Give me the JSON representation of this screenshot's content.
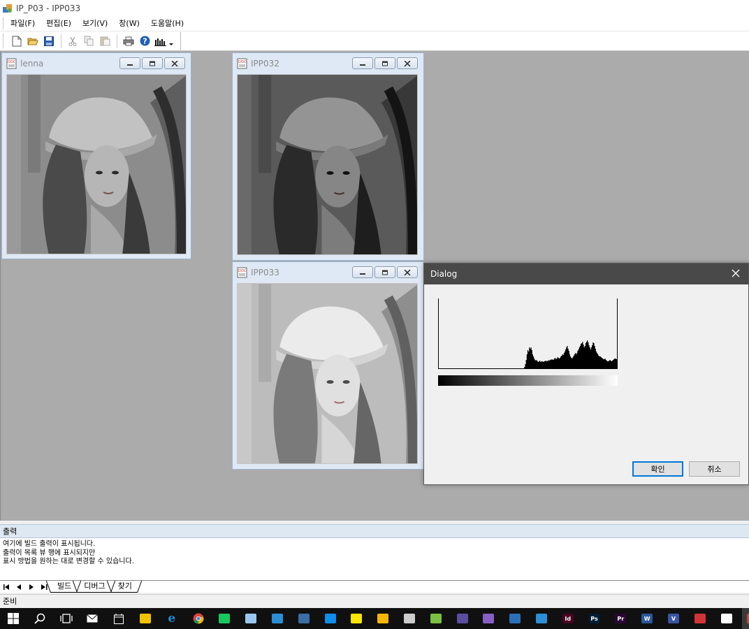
{
  "window": {
    "title": "IP_P03 - IPP033"
  },
  "menu": [
    {
      "label": "파일(F)"
    },
    {
      "label": "편집(E)"
    },
    {
      "label": "보기(V)"
    },
    {
      "label": "창(W)"
    },
    {
      "label": "도움말(H)"
    }
  ],
  "toolbar": [
    "new-icon",
    "open-icon",
    "save-icon",
    "cut-icon",
    "copy-icon",
    "paste-icon",
    "print-icon",
    "help-icon",
    "histogram-icon"
  ],
  "children": [
    {
      "title": "lenna",
      "tone": "medium"
    },
    {
      "title": "IPP032",
      "tone": "dark"
    },
    {
      "title": "IPP033",
      "tone": "light"
    }
  ],
  "dialog": {
    "title": "Dialog",
    "ok_label": "확인",
    "cancel_label": "취소",
    "histogram_profile": [
      0,
      0,
      0,
      0,
      0,
      0,
      0,
      0,
      0,
      0,
      0,
      0,
      0,
      0,
      0,
      0,
      0,
      0,
      0,
      0,
      0,
      0,
      0,
      0,
      0,
      0,
      0,
      0,
      0,
      0,
      0,
      0,
      0,
      0,
      0,
      0,
      0,
      0,
      0,
      0,
      0,
      0,
      0,
      0,
      0,
      0,
      0,
      0,
      0,
      0,
      0,
      0,
      0,
      0,
      0,
      0,
      0,
      0,
      0,
      0,
      0,
      0,
      0,
      0,
      0,
      0,
      0,
      0,
      0,
      0,
      0,
      0,
      0,
      0,
      0,
      0,
      0,
      0,
      0,
      0,
      0,
      0,
      0,
      0,
      0,
      0,
      0,
      0,
      0,
      0,
      0,
      0,
      0,
      0,
      0,
      0,
      0,
      0,
      0,
      0,
      0,
      0,
      0,
      0,
      0,
      0,
      0,
      0.02,
      0.06,
      0.12,
      0.2,
      0.26,
      0.24,
      0.3,
      0.28,
      0.3,
      0.26,
      0.2,
      0.17,
      0.14,
      0.12,
      0.11,
      0.12,
      0.1,
      0.09,
      0.1,
      0.11,
      0.09,
      0.1,
      0.1,
      0.09,
      0.1,
      0.1,
      0.11,
      0.1,
      0.11,
      0.1,
      0.12,
      0.11,
      0.12,
      0.13,
      0.12,
      0.13,
      0.12,
      0.14,
      0.15,
      0.13,
      0.14,
      0.16,
      0.15,
      0.14,
      0.15,
      0.17,
      0.18,
      0.2,
      0.19,
      0.22,
      0.24,
      0.27,
      0.3,
      0.32,
      0.28,
      0.25,
      0.2,
      0.17,
      0.15,
      0.14,
      0.16,
      0.18,
      0.2,
      0.22,
      0.2,
      0.22,
      0.25,
      0.27,
      0.3,
      0.32,
      0.35,
      0.36,
      0.38,
      0.34,
      0.3,
      0.32,
      0.36,
      0.38,
      0.4,
      0.37,
      0.33,
      0.3,
      0.27,
      0.3,
      0.33,
      0.37,
      0.36,
      0.32,
      0.28,
      0.24,
      0.22,
      0.2,
      0.18,
      0.17,
      0.17,
      0.16,
      0.15,
      0.14,
      0.13,
      0.13,
      0.14,
      0.12,
      0.11,
      0.1,
      0.1,
      0.11,
      0.12,
      0.11,
      0.1,
      0.11,
      0.12,
      0.13,
      0.14,
      0.14,
      0.13,
      0.13
    ]
  },
  "output": {
    "header": "출력",
    "lines": [
      "여기에 빌드 출력이 표시됩니다.",
      "출력이 목록 뷰 행에 표시되지만",
      "표시 방법을 원하는 대로 변경할 수 있습니다."
    ],
    "tabs": [
      {
        "label": "빌드"
      },
      {
        "label": "디버그"
      },
      {
        "label": "찾기"
      }
    ]
  },
  "status": {
    "text": "준비"
  },
  "taskbar": {
    "items": [
      {
        "icon": "windows-start-icon",
        "color": "#ffffff",
        "glyph": ""
      },
      {
        "icon": "search-icon",
        "color": "#ffffff",
        "glyph": ""
      },
      {
        "icon": "task-view-icon",
        "color": "#ffffff",
        "glyph": ""
      },
      {
        "icon": "mail-icon",
        "color": "#ffffff",
        "glyph": ""
      },
      {
        "icon": "calendar-icon",
        "color": "#ffffff",
        "glyph": ""
      },
      {
        "icon": "file-explorer-icon",
        "color": "#f2c200",
        "glyph": ""
      },
      {
        "icon": "internet-explorer-icon",
        "color": "#1f8ad6",
        "glyph": "e"
      },
      {
        "icon": "chrome-icon",
        "color": "#db4437",
        "glyph": ""
      },
      {
        "icon": "naver-whale-icon",
        "color": "#18c75e",
        "glyph": ""
      },
      {
        "icon": "notepad-icon",
        "color": "#9ac7f0",
        "glyph": ""
      },
      {
        "icon": "visual-studio-code-icon",
        "color": "#2b8fd6",
        "glyph": ""
      },
      {
        "icon": "steam-icon",
        "color": "#3a6ea5",
        "glyph": ""
      },
      {
        "icon": "teamviewer-icon",
        "color": "#0e8ee9",
        "glyph": ""
      },
      {
        "icon": "kakaotalk-icon",
        "color": "#fee500",
        "glyph": ""
      },
      {
        "icon": "network-icon",
        "color": "#f6b700",
        "glyph": ""
      },
      {
        "icon": "media-icon",
        "color": "#cccccc",
        "glyph": ""
      },
      {
        "icon": "android-icon",
        "color": "#7bc043",
        "glyph": ""
      },
      {
        "icon": "eclipse-icon",
        "color": "#5b4ea0",
        "glyph": ""
      },
      {
        "icon": "visual-studio-icon",
        "color": "#865fc5",
        "glyph": ""
      },
      {
        "icon": "sourcetree-icon",
        "color": "#2c6fb8",
        "glyph": ""
      },
      {
        "icon": "maps-icon",
        "color": "#2b8fd6",
        "glyph": ""
      },
      {
        "icon": "indesign-icon",
        "color": "#49021f",
        "glyph": "Id"
      },
      {
        "icon": "photoshop-icon",
        "color": "#001d34",
        "glyph": "Ps"
      },
      {
        "icon": "premiere-icon",
        "color": "#2a0634",
        "glyph": "Pr"
      },
      {
        "icon": "word-icon",
        "color": "#2b579a",
        "glyph": "W"
      },
      {
        "icon": "visio-icon",
        "color": "#3955a3",
        "glyph": "V"
      },
      {
        "icon": "red-app-icon",
        "color": "#d13438",
        "glyph": ""
      },
      {
        "icon": "sticky-notes-icon",
        "color": "#ffffff",
        "glyph": ""
      },
      {
        "icon": "ip-p03-app-icon",
        "color": "#c94c3c",
        "glyph": ""
      }
    ]
  }
}
